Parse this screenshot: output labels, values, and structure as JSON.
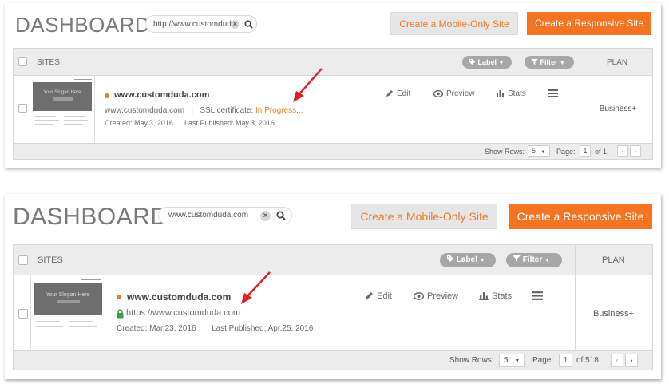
{
  "colors": {
    "accent": "#f47421",
    "header_bg": "#ececec",
    "pill_bg": "#a7a7a7",
    "annotation_arrow": "#e02020",
    "secure_lock": "#3aa040"
  },
  "icons": [
    "search-icon",
    "clear-icon",
    "tag-icon",
    "filter-icon",
    "chevron-down-icon",
    "edit-icon",
    "preview-icon",
    "stats-icon",
    "menu-icon",
    "lock-icon",
    "arrow-annotation"
  ],
  "top": {
    "title": "DASHBOARD",
    "search_value": "http://www.customduda.c",
    "btn_mobile": "Create a Mobile-Only Site",
    "btn_responsive": "Create a Responsive Site",
    "header": {
      "sites": "SITES",
      "label": "Label",
      "filter": "Filter",
      "plan": "PLAN"
    },
    "row": {
      "thumb_slogan": "Your Slogan Here",
      "site_name": "www.customduda.com",
      "url": "www.customduda.com",
      "separator": "|",
      "ssl_label": "SSL certificate:",
      "ssl_status": "In Progress...",
      "created": "Created: May.3, 2016",
      "published": "Last Published: May.3, 2016",
      "edit": "Edit",
      "preview": "Preview",
      "stats": "Stats",
      "plan": "Business+"
    },
    "footer": {
      "show_rows": "Show Rows:",
      "rows": "5",
      "page_label": "Page:",
      "page": "1",
      "of": "of 1"
    }
  },
  "bottom": {
    "title": "DASHBOARD",
    "search_value": "www.customduda.com",
    "btn_mobile": "Create a Mobile-Only Site",
    "btn_responsive": "Create a Responsive Site",
    "header": {
      "sites": "SITES",
      "label": "Label",
      "filter": "Filter",
      "plan": "PLAN"
    },
    "row": {
      "thumb_slogan": "Your Slogan Here",
      "site_name": "www.customduda.com",
      "url": "https://www.customduda.com",
      "created": "Created: Mar.23, 2016",
      "published": "Last Published: Apr.25, 2016",
      "edit": "Edit",
      "preview": "Preview",
      "stats": "Stats",
      "plan": "Business+"
    },
    "footer": {
      "show_rows": "Show Rows:",
      "rows": "5",
      "page_label": "Page:",
      "page": "1",
      "of": "of 518"
    }
  }
}
